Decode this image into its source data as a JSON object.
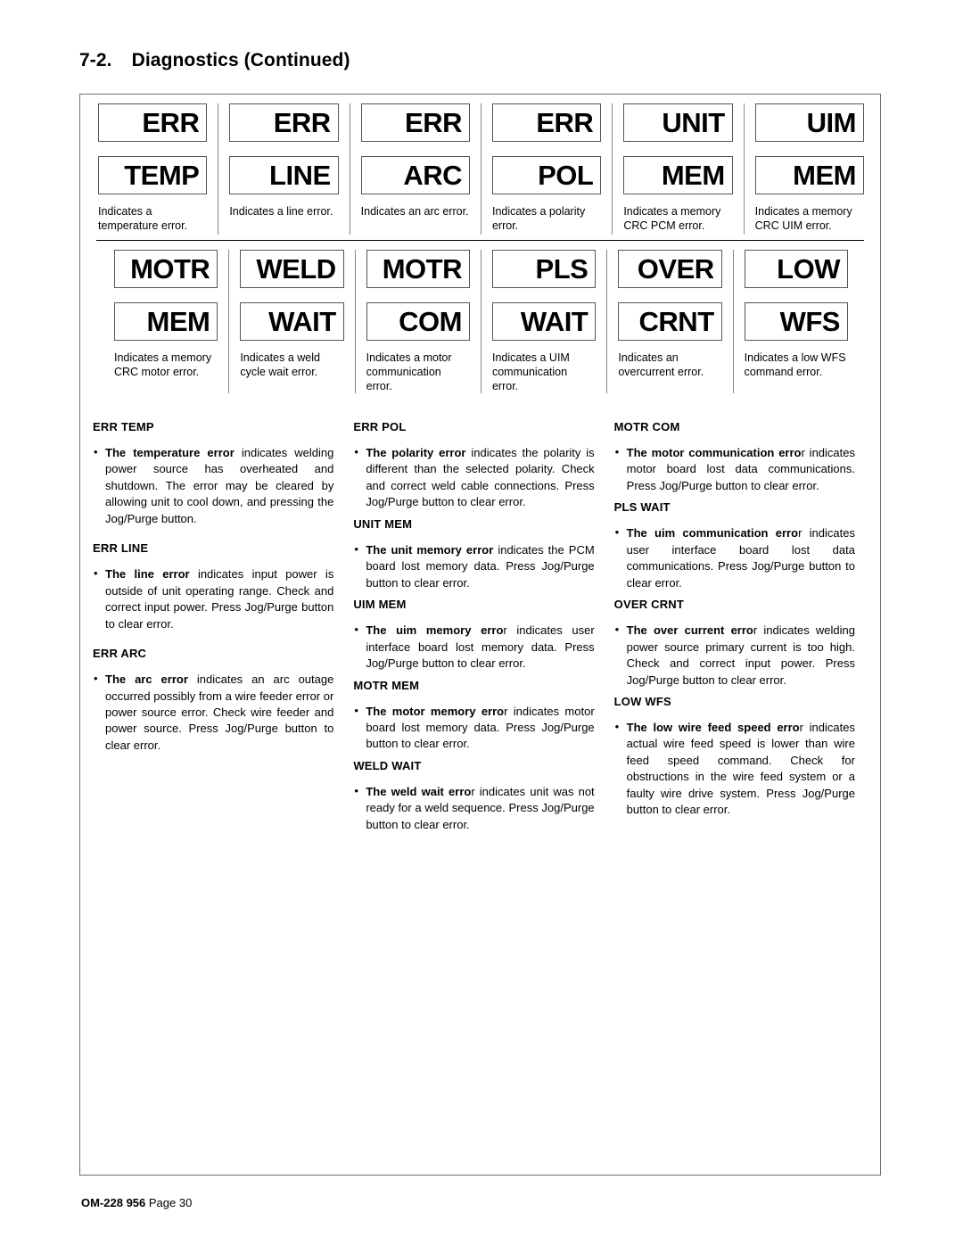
{
  "heading": {
    "section_number": "7-2.",
    "title": "Diagnostics (Continued)"
  },
  "code_grid": {
    "rows": [
      {
        "cells": [
          {
            "line1": "ERR",
            "line2": "TEMP",
            "caption": "Indicates a temperature error."
          },
          {
            "line1": "ERR",
            "line2": "LINE",
            "caption": "Indicates a line error."
          },
          {
            "line1": "ERR",
            "line2": "ARC",
            "caption": "Indicates an arc error."
          },
          {
            "line1": "ERR",
            "line2": "POL",
            "caption": "Indicates a polarity error."
          },
          {
            "line1": "UNIT",
            "line2": "MEM",
            "caption": "Indicates a memory CRC PCM error."
          },
          {
            "line1": "UIM",
            "line2": "MEM",
            "caption": "Indicates a memory CRC UIM error."
          }
        ]
      },
      {
        "cells": [
          {
            "line1": "MOTR",
            "line2": "MEM",
            "caption": "Indicates a memory CRC motor error."
          },
          {
            "line1": "WELD",
            "line2": "WAIT",
            "caption": "Indicates a weld cycle wait error."
          },
          {
            "line1": "MOTR",
            "line2": "COM",
            "caption": "Indicates a motor communication error."
          },
          {
            "line1": "PLS",
            "line2": "WAIT",
            "caption": "Indicates a UIM communication error."
          },
          {
            "line1": "OVER",
            "line2": "CRNT",
            "caption": "Indicates an overcurrent error."
          },
          {
            "line1": "LOW",
            "line2": "WFS",
            "caption": "Indicates a low WFS command error."
          }
        ]
      }
    ]
  },
  "descriptions": {
    "columns": [
      {
        "blocks": [
          {
            "head": "ERR TEMP",
            "bullet_lead": "The temperature error",
            "bullet_rest": " indicates welding power source has overheated and shutdown. The error may be cleared by allowing unit to cool down, and pressing the Jog/Purge button."
          },
          {
            "head": "ERR LINE",
            "bullet_lead": "The line error",
            "bullet_rest": " indicates input power is outside of unit operating range. Check and correct input power. Press Jog/Purge button to clear error."
          },
          {
            "head": "ERR ARC",
            "bullet_lead": "The arc error",
            "bullet_rest": " indicates an arc outage occurred possibly from a wire feeder error or power source error. Check wire feeder and power source. Press Jog/Purge button to clear error."
          }
        ]
      },
      {
        "blocks": [
          {
            "head": "ERR POL",
            "bullet_lead": "The polarity error",
            "bullet_rest": " indicates the polarity is different than the selected polarity. Check and correct weld cable connections. Press Jog/Purge button to clear error."
          },
          {
            "head": "UNIT MEM",
            "bullet_lead": "The unit memory error",
            "bullet_rest": " indicates the PCM board lost memory data. Press Jog/Purge button to clear error."
          },
          {
            "head": "UIM MEM",
            "bullet_lead": "The uim memory erro",
            "bullet_rest": "r indicates user interface board lost memory data. Press Jog/Purge button to clear error."
          },
          {
            "head": "MOTR MEM",
            "bullet_lead": "The motor memory erro",
            "bullet_rest": "r indicates motor board lost memory data. Press Jog/Purge button to clear error."
          },
          {
            "head": "WELD WAIT",
            "bullet_lead": "The weld wait erro",
            "bullet_rest": "r indicates unit was not ready for a weld sequence. Press Jog/Purge button to clear error."
          }
        ]
      },
      {
        "blocks": [
          {
            "head": "MOTR COM",
            "bullet_lead": "The motor communication erro",
            "bullet_rest": "r indicates motor board lost data communications. Press Jog/Purge button to clear error."
          },
          {
            "head": "PLS WAIT",
            "bullet_lead": "The uim communication erro",
            "bullet_rest": "r indicates user interface board lost data communications. Press Jog/Purge button to clear error."
          },
          {
            "head": "OVER CRNT",
            "bullet_lead": "The over current erro",
            "bullet_rest": "r indicates welding power source primary current is too high. Check and correct input power. Press Jog/Purge button to clear error."
          },
          {
            "head": "LOW WFS",
            "bullet_lead": "The low wire feed speed erro",
            "bullet_rest": "r indicates actual wire feed speed is lower than wire feed speed command. Check for obstructions in the wire feed system or a faulty wire drive system. Press Jog/Purge button to clear error."
          }
        ]
      }
    ]
  },
  "footer": {
    "doc_number": "OM-228 956",
    "page_label": " Page 30"
  },
  "bullet_glyph": "•"
}
